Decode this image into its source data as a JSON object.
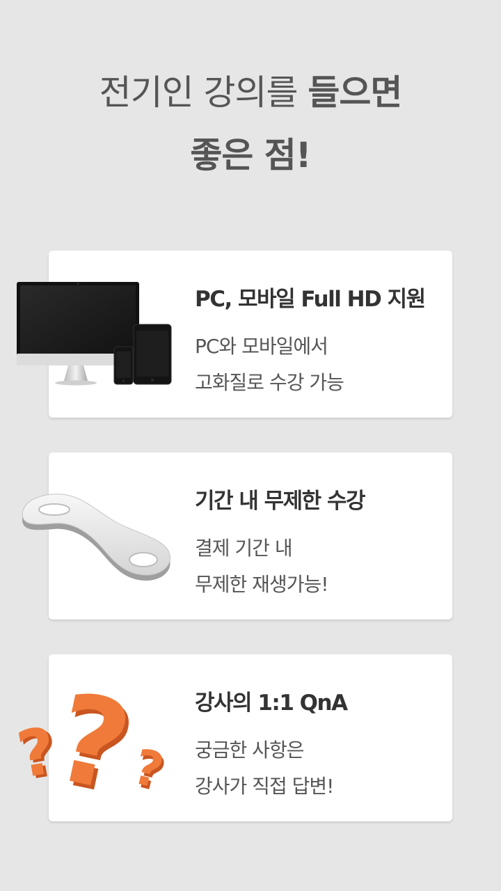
{
  "headline": {
    "line1_normal": "전기인 강의를 ",
    "line1_bold": "들으면",
    "line2": "좋은 점!"
  },
  "cards": [
    {
      "icon": "devices-icon",
      "title": "PC, 모바일 Full HD 지원",
      "desc_line1": "PC와 모바일에서",
      "desc_line2": "고화질로 수강 가능"
    },
    {
      "icon": "infinity-icon",
      "title": "기간 내 무제한 수강",
      "desc_line1": "결제 기간 내",
      "desc_line2": "무제한 재생가능!"
    },
    {
      "icon": "question-marks-icon",
      "title": "강사의 1:1 QnA",
      "desc_line1": "궁금한 사항은",
      "desc_line2": "강사가 직접 답변!"
    }
  ],
  "colors": {
    "background": "#e6e6e6",
    "card": "#ffffff",
    "heading_text": "#555555",
    "title_text": "#333333",
    "accent_orange": "#f07a3a"
  }
}
